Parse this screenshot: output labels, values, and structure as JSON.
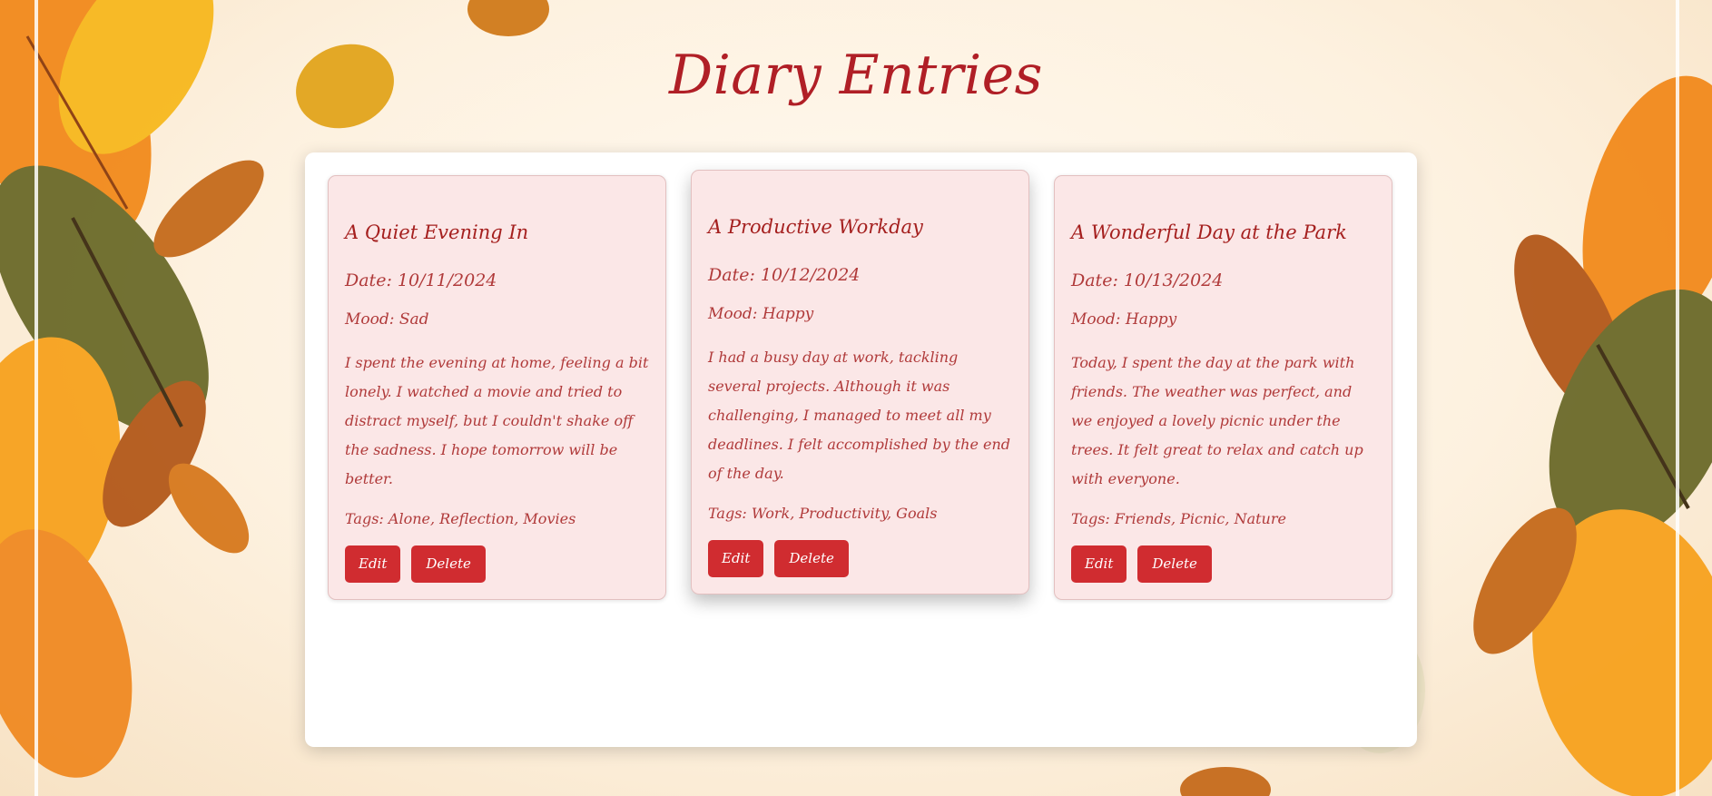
{
  "page": {
    "title": "Diary Entries"
  },
  "entries": [
    {
      "title": "A Quiet Evening In",
      "date": "Date: 10/11/2024",
      "mood": "Mood: Sad",
      "body": "I spent the evening at home, feeling a bit lonely. I watched a movie and tried to distract myself, but I couldn't shake off the sadness. I hope tomorrow will be better.",
      "tags": "Tags: Alone, Reflection, Movies",
      "edit_label": "Edit",
      "delete_label": "Delete"
    },
    {
      "title": "A Productive Workday",
      "date": "Date: 10/12/2024",
      "mood": "Mood: Happy",
      "body": "I had a busy day at work, tackling several projects. Although it was challenging, I managed to meet all my deadlines. I felt accomplished by the end of the day.",
      "tags": "Tags: Work, Productivity, Goals",
      "edit_label": "Edit",
      "delete_label": "Delete"
    },
    {
      "title": "A Wonderful Day at the Park",
      "date": "Date: 10/13/2024",
      "mood": "Mood: Happy",
      "body": "Today, I spent the day at the park with friends. The weather was perfect, and we enjoyed a lovely picnic under the trees. It felt great to relax and catch up with everyone.",
      "tags": "Tags: Friends, Picnic, Nature",
      "edit_label": "Edit",
      "delete_label": "Delete"
    }
  ],
  "colors": {
    "accent": "#d02c30",
    "title": "#b01f26",
    "card_bg": "#fbe7e7",
    "leaf_orange": "#f28a1c",
    "leaf_yellow": "#f7b81e",
    "leaf_green": "#6b6a2a",
    "leaf_brown": "#b3581a"
  }
}
